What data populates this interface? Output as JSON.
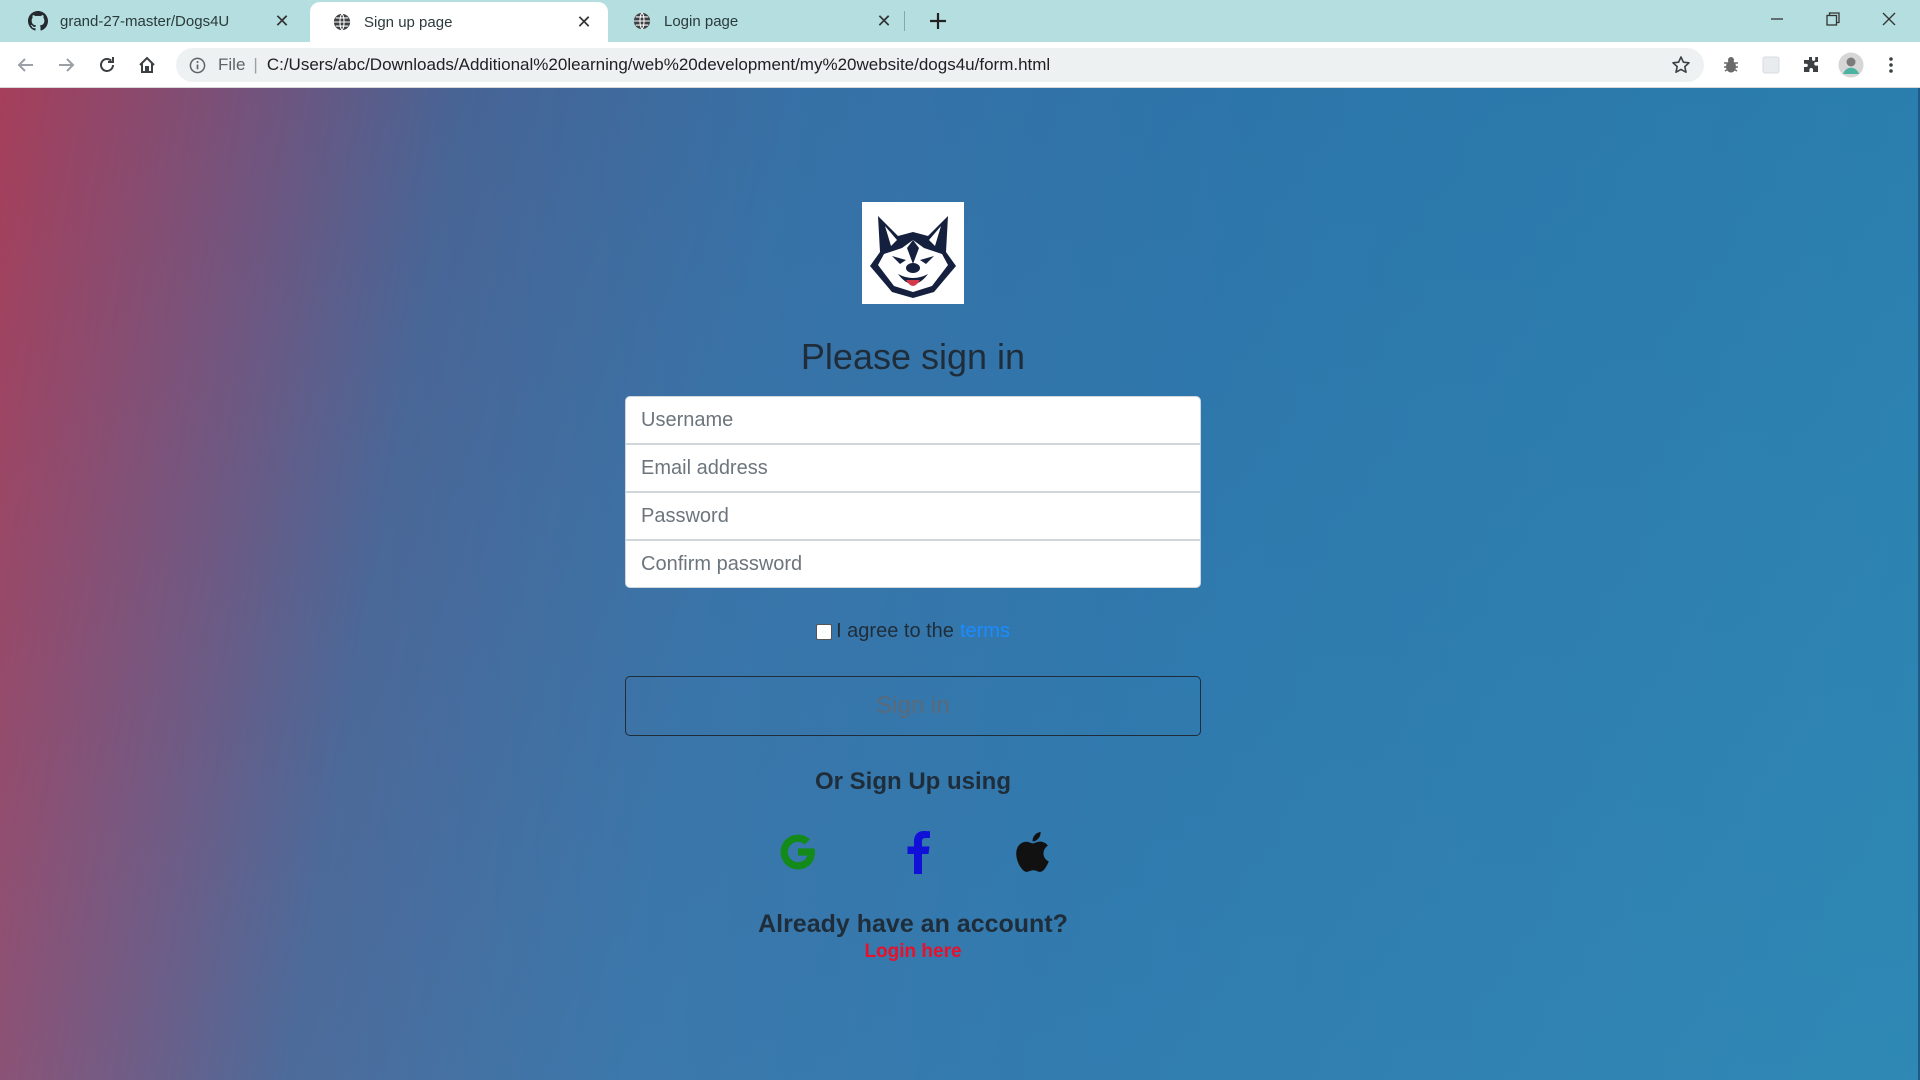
{
  "browser": {
    "tabs": [
      {
        "title": "grand-27-master/Dogs4U",
        "icon": "github-icon"
      },
      {
        "title": "Sign up page",
        "icon": "globe-icon",
        "active": true
      },
      {
        "title": "Login page",
        "icon": "globe-icon"
      }
    ],
    "address": {
      "scheme": "File",
      "url": "C:/Users/abc/Downloads/Additional%20learning/web%20development/my%20website/dogs4u/form.html"
    }
  },
  "page": {
    "heading": "Please sign in",
    "fields": {
      "username_placeholder": "Username",
      "email_placeholder": "Email address",
      "password_placeholder": "Password",
      "confirm_placeholder": "Confirm password"
    },
    "agree_text": "I agree to the",
    "terms_link": "terms",
    "signin_label": "Sign in",
    "or_text": "Or Sign Up using",
    "social": [
      "google-icon",
      "facebook-icon",
      "apple-icon"
    ],
    "already_text": "Already have an account?",
    "login_link": "Login here",
    "colors": {
      "google": "#138a1a",
      "facebook": "#1010d8",
      "apple": "#111111",
      "link_blue": "#1a8cff",
      "link_red": "#e8102a"
    }
  }
}
